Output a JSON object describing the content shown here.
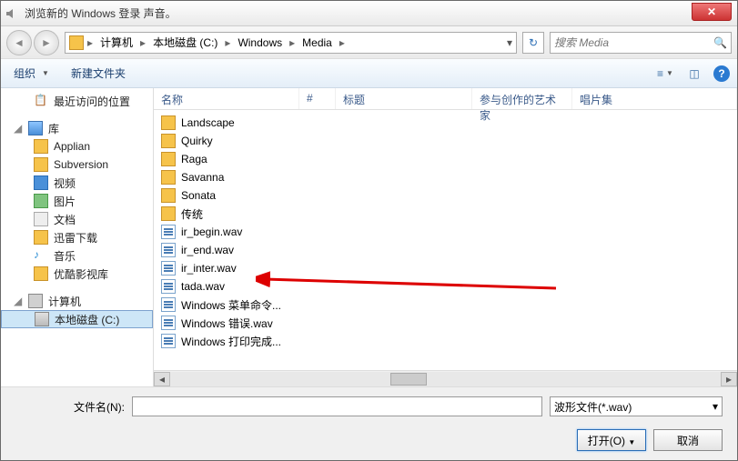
{
  "title": "浏览新的 Windows 登录 声音。",
  "breadcrumb": {
    "items": [
      "计算机",
      "本地磁盘 (C:)",
      "Windows",
      "Media"
    ]
  },
  "search": {
    "placeholder": "搜索 Media"
  },
  "toolbar": {
    "organize": "组织",
    "new_folder": "新建文件夹"
  },
  "sidebar": {
    "recent": "最近访问的位置",
    "libraries": "库",
    "lib_items": [
      "Applian",
      "Subversion",
      "视频",
      "图片",
      "文档",
      "迅雷下载",
      "音乐",
      "优酷影视库"
    ],
    "computer": "计算机",
    "disk": "本地磁盘 (C:)"
  },
  "columns": {
    "name": "名称",
    "number": "#",
    "title": "标题",
    "artists": "参与创作的艺术家",
    "album": "唱片集"
  },
  "files": [
    {
      "name": "Landscape",
      "type": "folder"
    },
    {
      "name": "Quirky",
      "type": "folder"
    },
    {
      "name": "Raga",
      "type": "folder"
    },
    {
      "name": "Savanna",
      "type": "folder"
    },
    {
      "name": "Sonata",
      "type": "folder"
    },
    {
      "name": "传统",
      "type": "folder"
    },
    {
      "name": "ir_begin.wav",
      "type": "wav"
    },
    {
      "name": "ir_end.wav",
      "type": "wav"
    },
    {
      "name": "ir_inter.wav",
      "type": "wav"
    },
    {
      "name": "tada.wav",
      "type": "wav"
    },
    {
      "name": "Windows 菜单命令...",
      "type": "wav"
    },
    {
      "name": "Windows 错误.wav",
      "type": "wav"
    },
    {
      "name": "Windows 打印完成...",
      "type": "wav"
    }
  ],
  "footer": {
    "filename_label": "文件名(N):",
    "filter": "波形文件(*.wav)",
    "open": "打开(O)",
    "cancel": "取消"
  }
}
